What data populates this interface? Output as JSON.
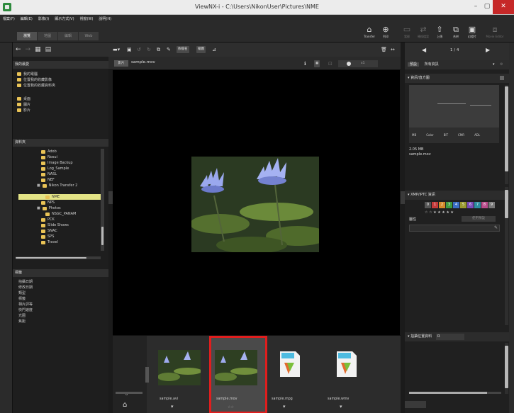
{
  "window": {
    "title": "ViewNX-i - C:\\Users\\NikonUser\\Pictures\\NME",
    "buttons": {
      "minimize": "–",
      "maximize": "▢",
      "close": "✕"
    }
  },
  "menu": [
    "檔案(F)",
    "編輯(E)",
    "影像(I)",
    "顯示方式(V)",
    "視窗(W)",
    "說明(H)"
  ],
  "tabs": [
    {
      "label": "瀏覽",
      "active": true
    },
    {
      "label": "地圖",
      "active": false
    },
    {
      "label": "編輯",
      "active": false
    },
    {
      "label": "Web",
      "active": false
    }
  ],
  "toolbar": {
    "transfer": "Transfer",
    "print": "列印",
    "email": "電郵",
    "convert": "轉換檔案",
    "upload": "上傳",
    "merge": "合併",
    "slideshow": "幻燈片",
    "nx_studio": "Movie Editor"
  },
  "left_panel": {
    "favorites_title": "我的最愛",
    "favorites": [
      "我的電腦",
      "位置我的收藏影像",
      "位置我的收藏資料夾"
    ],
    "places": [
      "桌面",
      "圖片",
      "影片"
    ],
    "folders_title": "資料夾",
    "folders": [
      "Adob",
      "Nosui",
      "Image Backup",
      "Log_Sample",
      "NASL",
      "NEF",
      "Nikon Transfer 2",
      "NME",
      "NPS",
      "Photos",
      "NSGC_PANAM",
      "PCK",
      "Slide Shows",
      "SNAC",
      "SPS",
      "Travel"
    ],
    "selected_folder": "NME",
    "metadata_title": "標籤",
    "metadata_items": [
      "拍攝日期",
      "修改日期",
      "類型",
      "標籤",
      "相片評等",
      "快門速度",
      "光圈",
      "焦距"
    ]
  },
  "viewer": {
    "file_tag": "影片",
    "filename": "sample.mov",
    "sort_label": "依檔名",
    "view_label": "縮圖",
    "zoom_text": "x1"
  },
  "filmstrip": {
    "items": [
      {
        "name": "sample.avi"
      },
      {
        "name": "sample.mov",
        "selected": true
      },
      {
        "name": "sample.mpg"
      },
      {
        "name": "sample.wmv"
      }
    ],
    "count_label": "0"
  },
  "right_panel": {
    "nav_counter": "1 / 4",
    "preset_label": "預設",
    "preset_value": "所有資訊",
    "histogram_title": "資訊/直方圖",
    "histogram_labels": [
      "MB",
      "Color",
      "BIT",
      "CMR",
      "ADL"
    ],
    "file_size": "2.05 MB",
    "file_name": "sample.mov",
    "xmp_title": "XMP/IPTC 資訊",
    "label_numbers": [
      "0",
      "1",
      "2",
      "3",
      "4",
      "5",
      "6",
      "7",
      "8",
      "9"
    ],
    "rating_stars": "☆ ☆ ★ ★ ★ ★ ★",
    "rating_label": "屬性",
    "caption_label": "關鍵字",
    "caption_button": "使用預設",
    "location_title": "拍攝位置資料",
    "location_value": "R"
  },
  "colors": {
    "selection_border": "#e01e1e",
    "folder_highlight": "#e4e486",
    "close_button": "#c62828"
  }
}
